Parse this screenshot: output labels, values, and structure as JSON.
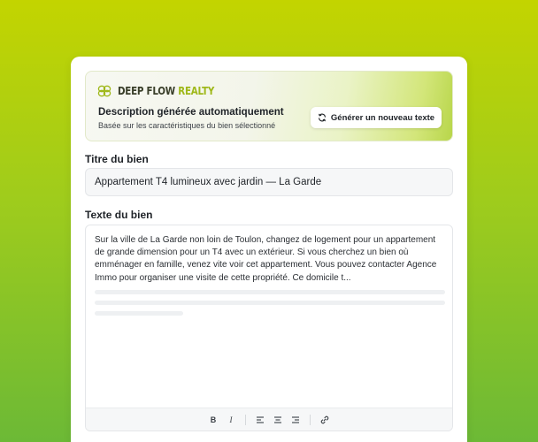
{
  "brand": {
    "name_primary": "DEEP FLOW",
    "name_accent": "REALTY"
  },
  "banner": {
    "title": "Description générée automatiquement",
    "subtitle": "Basée sur les caractéristiques du bien sélectionné",
    "generate_button_label": "Générer un nouveau texte"
  },
  "fields": {
    "title_label": "Titre du bien",
    "title_value": "Appartement T4 lumineux avec jardin — La Garde",
    "text_label": "Texte du bien",
    "text_value": "Sur la ville de La Garde non loin de Toulon, changez de logement pour un appartement de grande dimension pour un T4 avec un extérieur. Si vous cherchez un bien où emménager en famille, venez vite voir cet appartement. Vous pouvez contacter Agence Immo pour organiser une visite de cette propriété. Ce domicile t..."
  },
  "toolbar": {
    "bold_label": "B",
    "italic_label": "I",
    "icons": [
      "bold-icon",
      "italic-icon",
      "align-left-icon",
      "align-center-icon",
      "align-right-icon",
      "link-icon"
    ]
  },
  "colors": {
    "accent": "#9fb81a",
    "background_top": "#c3d400",
    "background_bottom": "#6cb936"
  }
}
